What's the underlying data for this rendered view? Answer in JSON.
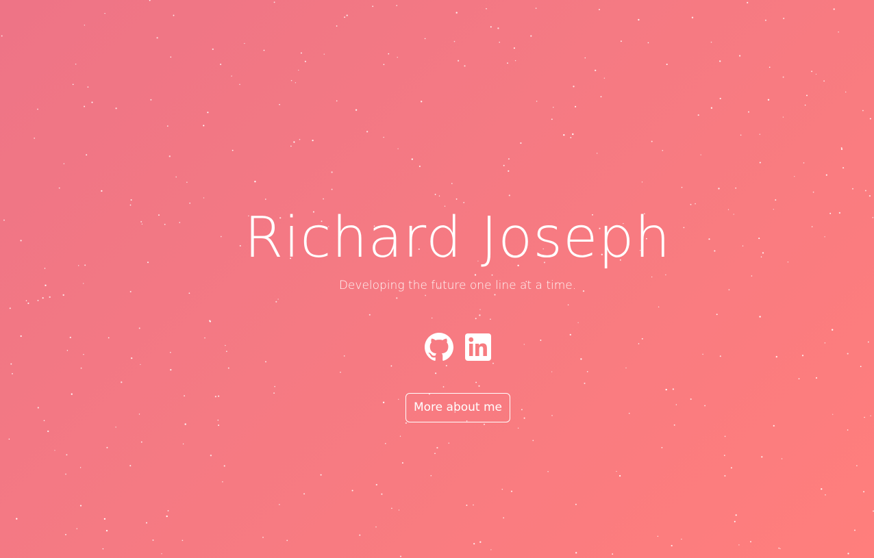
{
  "hero": {
    "name": "Richard Joseph",
    "tagline": "Developing the future one line at a time."
  },
  "social_links": [
    {
      "icon": "github-icon",
      "label": "GitHub"
    },
    {
      "icon": "linkedin-icon",
      "label": "LinkedIn"
    }
  ],
  "cta": {
    "label": "More about me"
  },
  "colors": {
    "gradient_start": "#ee7486",
    "gradient_end": "#ff7e7c",
    "text": "#ffffff",
    "stars": "#ffffff"
  }
}
